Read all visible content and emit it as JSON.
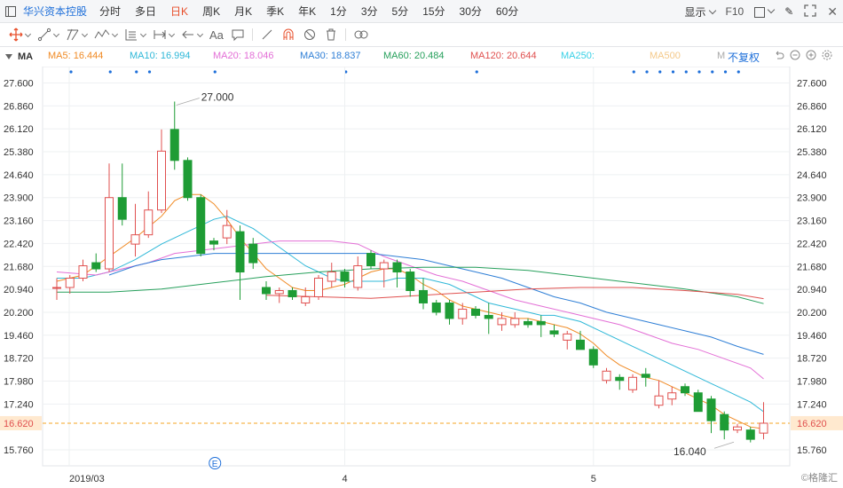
{
  "topbar": {
    "stock_name": "华兴资本控股",
    "timeframes": [
      "分时",
      "多日",
      "日K",
      "周K",
      "月K",
      "季K",
      "年K",
      "1分",
      "3分",
      "5分",
      "15分",
      "30分",
      "60分"
    ],
    "active_timeframe": "日K",
    "display_label": "显示",
    "f10_label": "F10"
  },
  "toolbar2": {
    "text_tool": "Aa"
  },
  "legend": {
    "indicator": "MA",
    "ma": [
      {
        "label": "MA5: 16.444",
        "color": "#f08a24"
      },
      {
        "label": "MA10: 16.994",
        "color": "#2fb8d8"
      },
      {
        "label": "MA20: 18.046",
        "color": "#e36fd6"
      },
      {
        "label": "MA30: 18.837",
        "color": "#2f7fd6"
      },
      {
        "label": "MA60: 20.484",
        "color": "#27a05c"
      },
      {
        "label": "MA120: 20.644",
        "color": "#e0504f"
      },
      {
        "label": "MA250:",
        "color": "#37d0e6"
      },
      {
        "label": "MA500",
        "color": "#f4c98a"
      },
      {
        "label": "M",
        "color": "#aaaaaa"
      }
    ],
    "fuquan": "不复权"
  },
  "chart_data": {
    "type": "candlestick",
    "y_ticks": [
      "27.600",
      "26.860",
      "26.120",
      "25.380",
      "24.640",
      "23.900",
      "23.160",
      "22.420",
      "21.680",
      "20.940",
      "20.200",
      "19.460",
      "18.720",
      "17.980",
      "17.240",
      "16.620",
      "15.760"
    ],
    "ylim": [
      15.5,
      27.8
    ],
    "x_labels": [
      {
        "label": "2019/03",
        "index": 0
      },
      {
        "label": "4",
        "index": 22
      },
      {
        "label": "5",
        "index": 41
      }
    ],
    "current_price": "16.620",
    "high_annotation": {
      "label": "27.000",
      "value": 27.0,
      "index": 9
    },
    "low_annotation": {
      "label": "16.040",
      "value": 16.04,
      "index": 52
    },
    "event_marker": "E",
    "event_index": 11,
    "colors": {
      "up": "#e0504f",
      "down": "#1e9c35",
      "current": "#f5a623"
    },
    "candles": [
      [
        21.0,
        21.3,
        20.6,
        21.0
      ],
      [
        21.0,
        21.4,
        20.8,
        21.3
      ],
      [
        21.3,
        21.9,
        21.2,
        21.7
      ],
      [
        21.8,
        22.1,
        21.5,
        21.6
      ],
      [
        21.6,
        25.0,
        21.5,
        23.9
      ],
      [
        23.9,
        25.0,
        23.0,
        23.2
      ],
      [
        22.4,
        23.7,
        22.0,
        22.7
      ],
      [
        22.7,
        24.1,
        22.6,
        23.5
      ],
      [
        23.5,
        26.1,
        23.4,
        25.4
      ],
      [
        26.1,
        27.0,
        24.8,
        25.1
      ],
      [
        25.1,
        25.2,
        23.8,
        23.9
      ],
      [
        23.9,
        24.0,
        22.0,
        22.1
      ],
      [
        22.5,
        22.6,
        22.2,
        22.4
      ],
      [
        22.6,
        23.5,
        22.4,
        23.0
      ],
      [
        22.8,
        23.0,
        20.6,
        21.5
      ],
      [
        22.4,
        22.6,
        21.6,
        21.8
      ],
      [
        21.0,
        21.2,
        20.6,
        20.8
      ],
      [
        20.8,
        21.0,
        20.5,
        20.9
      ],
      [
        20.9,
        21.0,
        20.6,
        20.7
      ],
      [
        20.5,
        21.0,
        20.4,
        20.7
      ],
      [
        20.7,
        21.4,
        20.6,
        21.3
      ],
      [
        21.2,
        21.8,
        21.0,
        21.5
      ],
      [
        21.5,
        21.6,
        21.0,
        21.2
      ],
      [
        21.0,
        22.0,
        20.9,
        21.7
      ],
      [
        22.1,
        22.2,
        21.6,
        21.7
      ],
      [
        21.6,
        21.9,
        21.0,
        21.8
      ],
      [
        21.8,
        21.9,
        21.0,
        21.5
      ],
      [
        21.5,
        21.6,
        20.7,
        20.9
      ],
      [
        20.9,
        21.3,
        20.3,
        20.5
      ],
      [
        20.5,
        20.6,
        20.1,
        20.2
      ],
      [
        20.5,
        20.6,
        19.8,
        20.0
      ],
      [
        20.0,
        20.5,
        19.8,
        20.3
      ],
      [
        20.3,
        20.4,
        20.0,
        20.1
      ],
      [
        20.1,
        20.5,
        19.5,
        20.0
      ],
      [
        19.8,
        20.2,
        19.6,
        20.0
      ],
      [
        19.8,
        20.2,
        19.7,
        20.0
      ],
      [
        19.9,
        20.0,
        19.7,
        19.8
      ],
      [
        19.9,
        20.1,
        19.4,
        19.8
      ],
      [
        19.6,
        19.8,
        19.4,
        19.5
      ],
      [
        19.3,
        19.6,
        19.0,
        19.5
      ],
      [
        19.3,
        19.6,
        19.0,
        19.0
      ],
      [
        19.0,
        19.1,
        18.4,
        18.5
      ],
      [
        18.0,
        18.4,
        17.9,
        18.3
      ],
      [
        18.1,
        18.2,
        17.7,
        18.0
      ],
      [
        17.7,
        18.2,
        17.6,
        18.1
      ],
      [
        18.2,
        18.4,
        17.8,
        18.1
      ],
      [
        17.2,
        18.0,
        17.1,
        17.5
      ],
      [
        17.4,
        17.8,
        17.2,
        17.6
      ],
      [
        17.8,
        17.9,
        17.5,
        17.6
      ],
      [
        17.6,
        17.7,
        17.0,
        17.0
      ],
      [
        17.4,
        17.5,
        16.3,
        16.7
      ],
      [
        16.9,
        17.0,
        16.1,
        16.4
      ],
      [
        16.4,
        16.6,
        16.3,
        16.5
      ],
      [
        16.4,
        16.5,
        16.0,
        16.1
      ],
      [
        16.3,
        17.3,
        16.1,
        16.62
      ]
    ],
    "ma_lines": [
      {
        "name": "MA5",
        "color": "#f08a24",
        "points": [
          [
            0,
            21.2
          ],
          [
            2,
            21.4
          ],
          [
            4,
            22.0
          ],
          [
            6,
            22.6
          ],
          [
            8,
            23.3
          ],
          [
            9,
            23.8
          ],
          [
            10,
            24.0
          ],
          [
            11,
            24.0
          ],
          [
            12,
            23.7
          ],
          [
            13,
            23.2
          ],
          [
            14,
            22.6
          ],
          [
            15,
            22.1
          ],
          [
            16,
            21.6
          ],
          [
            17,
            21.3
          ],
          [
            18,
            21.0
          ],
          [
            19,
            20.9
          ],
          [
            20,
            20.9
          ],
          [
            21,
            21.0
          ],
          [
            22,
            21.1
          ],
          [
            23,
            21.3
          ],
          [
            24,
            21.5
          ],
          [
            25,
            21.6
          ],
          [
            26,
            21.6
          ],
          [
            27,
            21.4
          ],
          [
            28,
            21.1
          ],
          [
            29,
            20.9
          ],
          [
            30,
            20.6
          ],
          [
            31,
            20.4
          ],
          [
            32,
            20.3
          ],
          [
            33,
            20.2
          ],
          [
            34,
            20.1
          ],
          [
            35,
            20.0
          ],
          [
            36,
            20.0
          ],
          [
            37,
            19.9
          ],
          [
            38,
            19.8
          ],
          [
            39,
            19.7
          ],
          [
            40,
            19.5
          ],
          [
            41,
            19.2
          ],
          [
            42,
            18.8
          ],
          [
            43,
            18.5
          ],
          [
            44,
            18.3
          ],
          [
            45,
            18.1
          ],
          [
            46,
            18.0
          ],
          [
            47,
            17.8
          ],
          [
            48,
            17.6
          ],
          [
            49,
            17.4
          ],
          [
            50,
            17.2
          ],
          [
            51,
            16.9
          ],
          [
            52,
            16.7
          ],
          [
            53,
            16.5
          ],
          [
            54,
            16.44
          ]
        ]
      },
      {
        "name": "MA10",
        "color": "#2fb8d8",
        "points": [
          [
            0,
            21.3
          ],
          [
            2,
            21.3
          ],
          [
            4,
            21.5
          ],
          [
            6,
            21.9
          ],
          [
            8,
            22.4
          ],
          [
            9,
            22.6
          ],
          [
            10,
            22.8
          ],
          [
            11,
            23.0
          ],
          [
            12,
            23.2
          ],
          [
            13,
            23.3
          ],
          [
            14,
            23.1
          ],
          [
            15,
            22.9
          ],
          [
            16,
            22.6
          ],
          [
            17,
            22.3
          ],
          [
            18,
            22.0
          ],
          [
            19,
            21.7
          ],
          [
            20,
            21.5
          ],
          [
            21,
            21.3
          ],
          [
            22,
            21.2
          ],
          [
            23,
            21.2
          ],
          [
            24,
            21.2
          ],
          [
            25,
            21.2
          ],
          [
            26,
            21.3
          ],
          [
            27,
            21.3
          ],
          [
            28,
            21.3
          ],
          [
            29,
            21.2
          ],
          [
            30,
            21.1
          ],
          [
            31,
            20.9
          ],
          [
            32,
            20.7
          ],
          [
            33,
            20.5
          ],
          [
            34,
            20.4
          ],
          [
            35,
            20.3
          ],
          [
            36,
            20.2
          ],
          [
            37,
            20.1
          ],
          [
            38,
            20.1
          ],
          [
            39,
            20.0
          ],
          [
            40,
            19.9
          ],
          [
            41,
            19.7
          ],
          [
            42,
            19.5
          ],
          [
            43,
            19.3
          ],
          [
            44,
            19.1
          ],
          [
            45,
            18.9
          ],
          [
            46,
            18.7
          ],
          [
            47,
            18.5
          ],
          [
            48,
            18.3
          ],
          [
            49,
            18.1
          ],
          [
            50,
            17.9
          ],
          [
            51,
            17.7
          ],
          [
            52,
            17.5
          ],
          [
            53,
            17.3
          ],
          [
            54,
            16.99
          ]
        ]
      },
      {
        "name": "MA20",
        "color": "#e36fd6",
        "points": [
          [
            0,
            21.5
          ],
          [
            3,
            21.4
          ],
          [
            5,
            21.6
          ],
          [
            7,
            21.8
          ],
          [
            9,
            22.1
          ],
          [
            11,
            22.2
          ],
          [
            13,
            22.3
          ],
          [
            15,
            22.4
          ],
          [
            17,
            22.5
          ],
          [
            19,
            22.5
          ],
          [
            21,
            22.5
          ],
          [
            23,
            22.4
          ],
          [
            25,
            22.0
          ],
          [
            27,
            21.7
          ],
          [
            29,
            21.4
          ],
          [
            31,
            21.2
          ],
          [
            33,
            20.9
          ],
          [
            35,
            20.6
          ],
          [
            37,
            20.4
          ],
          [
            39,
            20.2
          ],
          [
            41,
            20.0
          ],
          [
            43,
            19.8
          ],
          [
            45,
            19.5
          ],
          [
            47,
            19.2
          ],
          [
            49,
            19.0
          ],
          [
            51,
            18.7
          ],
          [
            53,
            18.4
          ],
          [
            54,
            18.05
          ]
        ]
      },
      {
        "name": "MA30",
        "color": "#2f7fd6",
        "points": [
          [
            4,
            21.4
          ],
          [
            6,
            21.7
          ],
          [
            8,
            21.9
          ],
          [
            10,
            22.0
          ],
          [
            12,
            22.1
          ],
          [
            14,
            22.1
          ],
          [
            16,
            22.1
          ],
          [
            18,
            22.1
          ],
          [
            20,
            22.1
          ],
          [
            22,
            22.1
          ],
          [
            24,
            22.1
          ],
          [
            26,
            22.0
          ],
          [
            28,
            21.9
          ],
          [
            30,
            21.7
          ],
          [
            32,
            21.5
          ],
          [
            34,
            21.3
          ],
          [
            36,
            21.0
          ],
          [
            38,
            20.7
          ],
          [
            40,
            20.5
          ],
          [
            42,
            20.2
          ],
          [
            44,
            20.0
          ],
          [
            46,
            19.8
          ],
          [
            48,
            19.6
          ],
          [
            50,
            19.4
          ],
          [
            52,
            19.1
          ],
          [
            54,
            18.84
          ]
        ]
      },
      {
        "name": "MA60",
        "color": "#27a05c",
        "points": [
          [
            0,
            20.85
          ],
          [
            4,
            20.85
          ],
          [
            8,
            20.95
          ],
          [
            12,
            21.15
          ],
          [
            16,
            21.35
          ],
          [
            20,
            21.5
          ],
          [
            24,
            21.6
          ],
          [
            28,
            21.65
          ],
          [
            32,
            21.65
          ],
          [
            36,
            21.55
          ],
          [
            40,
            21.35
          ],
          [
            44,
            21.15
          ],
          [
            48,
            20.95
          ],
          [
            52,
            20.7
          ],
          [
            54,
            20.48
          ]
        ]
      },
      {
        "name": "MA120",
        "color": "#e0504f",
        "points": [
          [
            16,
            20.75
          ],
          [
            20,
            20.7
          ],
          [
            24,
            20.65
          ],
          [
            28,
            20.75
          ],
          [
            32,
            20.85
          ],
          [
            36,
            20.95
          ],
          [
            40,
            21.0
          ],
          [
            44,
            21.0
          ],
          [
            48,
            20.9
          ],
          [
            52,
            20.78
          ],
          [
            54,
            20.64
          ]
        ]
      }
    ]
  }
}
